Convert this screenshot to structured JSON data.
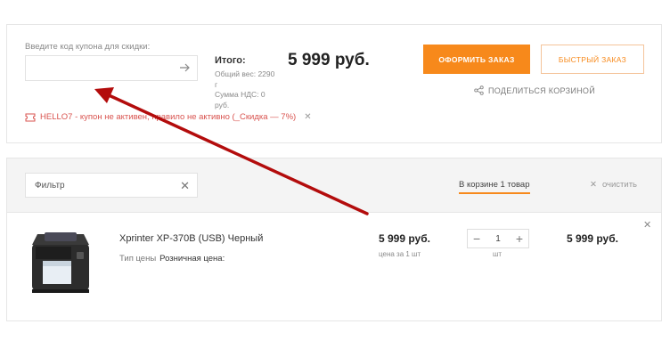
{
  "coupon": {
    "label": "Введите код купона для скидки:",
    "value": "",
    "applied_code_text": "HELLO7 - купон не активен, правило не активно (_Скидка — 7%)"
  },
  "summary": {
    "total_label": "Итого:",
    "weight": "Общий вес: 2290 г",
    "vat": "Сумма НДС: 0 руб.",
    "total_price": "5 999 руб."
  },
  "actions": {
    "order_button": "ОФОРМИТЬ ЗАКАЗ",
    "fast_order_button": "БЫСТРЫЙ ЗАКАЗ",
    "share_label": "ПОДЕЛИТЬСЯ КОРЗИНОЙ"
  },
  "filter": {
    "placeholder": "Фильтр",
    "cart_count": "В корзине 1 товар",
    "clear_label": "очистить"
  },
  "items": [
    {
      "name": "Xprinter XP-370B (USB) Черный",
      "price_type_label": "Тип цены",
      "price_type_value": "Розничная цена:",
      "unit_price": "5 999 руб.",
      "unit_note": "цена за 1 шт",
      "quantity": "1",
      "quantity_unit": "шт",
      "line_total": "5 999 руб."
    }
  ],
  "colors": {
    "accent": "#f7891b",
    "error": "#d9534f",
    "annotation_arrow": "#b30c0c"
  }
}
